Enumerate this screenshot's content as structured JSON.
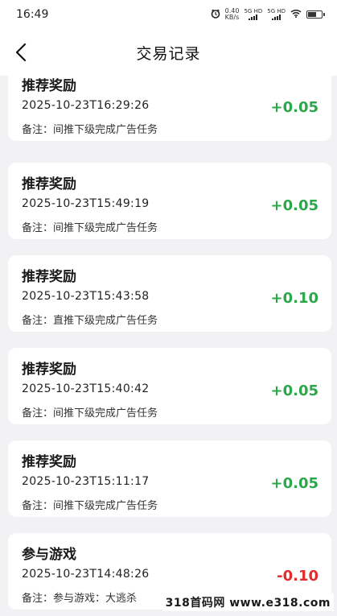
{
  "status_bar": {
    "time": "16:49",
    "net_speed_value": "0.40",
    "net_speed_unit": "KB/s",
    "sim1_label": "5G HD",
    "sim2_label": "5G HD"
  },
  "nav": {
    "title": "交易记录"
  },
  "records": [
    {
      "title": "推荐奖励",
      "time": "2025-10-23T16:29:26",
      "note": "备注：间推下级完成广告任务",
      "amount": "+0.05",
      "type": "positive"
    },
    {
      "title": "推荐奖励",
      "time": "2025-10-23T15:49:19",
      "note": "备注：间推下级完成广告任务",
      "amount": "+0.05",
      "type": "positive"
    },
    {
      "title": "推荐奖励",
      "time": "2025-10-23T15:43:58",
      "note": "备注：直推下级完成广告任务",
      "amount": "+0.10",
      "type": "positive"
    },
    {
      "title": "推荐奖励",
      "time": "2025-10-23T15:40:42",
      "note": "备注：间推下级完成广告任务",
      "amount": "+0.05",
      "type": "positive"
    },
    {
      "title": "推荐奖励",
      "time": "2025-10-23T15:11:17",
      "note": "备注：间推下级完成广告任务",
      "amount": "+0.05",
      "type": "positive"
    },
    {
      "title": "参与游戏",
      "time": "2025-10-23T14:48:26",
      "note": "备注：参与游戏：大逃杀",
      "amount": "-0.10",
      "type": "negative"
    }
  ],
  "colors": {
    "positive": "#2aa84a",
    "negative": "#e52a2a",
    "background": "#f2f2f4"
  },
  "watermark": "318首码网 www.e318.com"
}
